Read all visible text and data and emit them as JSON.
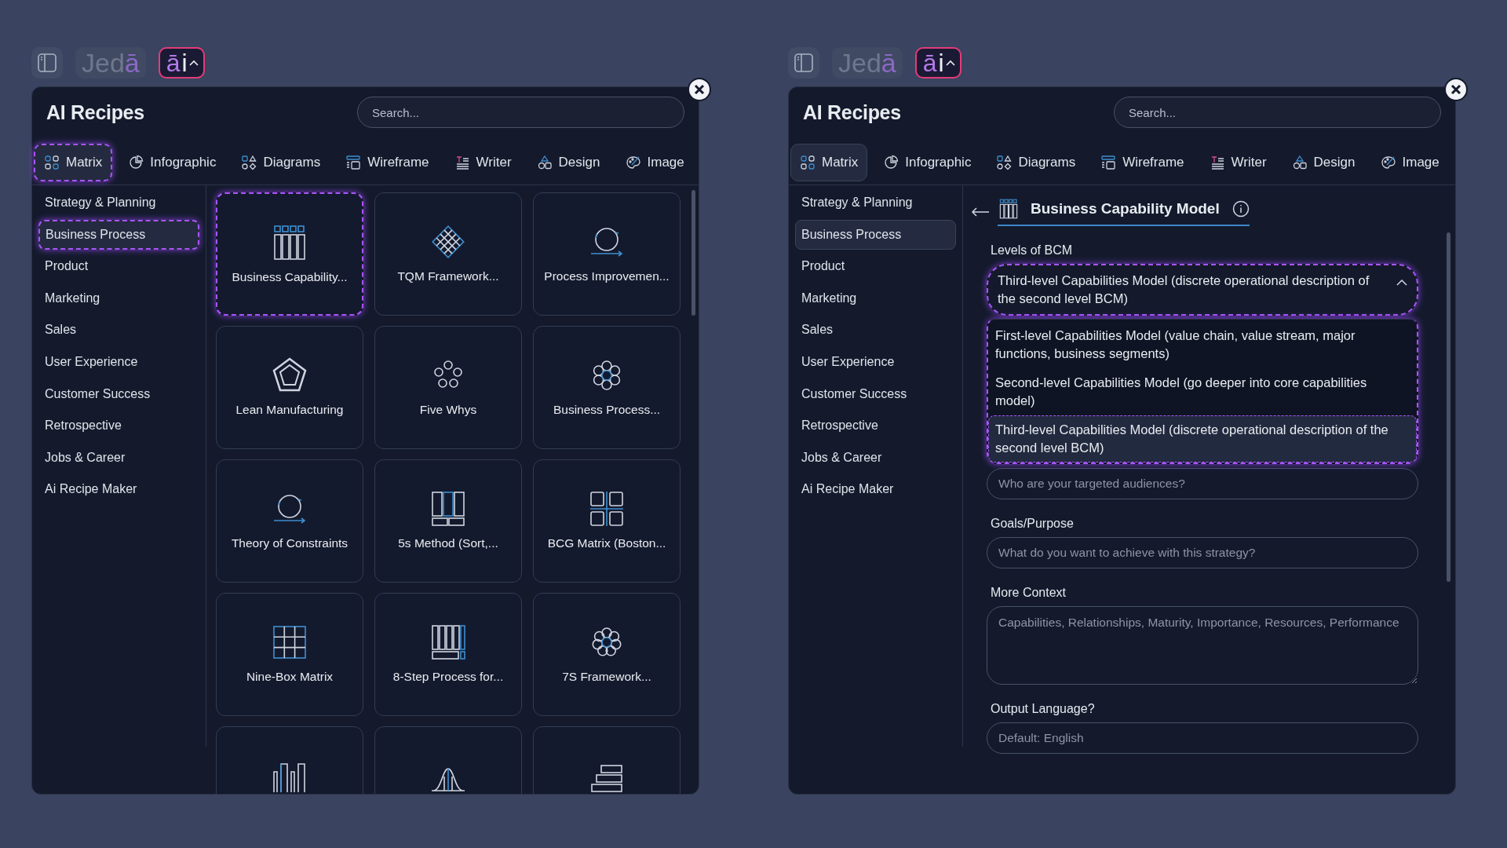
{
  "panels": [
    {
      "toolbar": {
        "logo": {
          "main": "Jed",
          "accent": "ā"
        },
        "ai_button": {
          "accent": "ā",
          "main": "i"
        }
      },
      "title": "AI Recipes",
      "search": {
        "placeholder": "Search..."
      },
      "tabs": [
        {
          "label": "Matrix",
          "selected": true,
          "focused": true
        },
        {
          "label": "Infographic",
          "selected": false,
          "focused": false
        },
        {
          "label": "Diagrams",
          "selected": false,
          "focused": false
        },
        {
          "label": "Wireframe",
          "selected": false,
          "focused": false
        },
        {
          "label": "Writer",
          "selected": false,
          "focused": false
        },
        {
          "label": "Design",
          "selected": false,
          "focused": false
        },
        {
          "label": "Image",
          "selected": false,
          "focused": false
        }
      ],
      "categories": [
        {
          "label": "Strategy & Planning",
          "selected": false,
          "focused": false
        },
        {
          "label": "Business Process",
          "selected": true,
          "focused": true
        },
        {
          "label": "Product",
          "selected": false,
          "focused": false
        },
        {
          "label": "Marketing",
          "selected": false,
          "focused": false
        },
        {
          "label": "Sales",
          "selected": false,
          "focused": false
        },
        {
          "label": "User Experience",
          "selected": false,
          "focused": false
        },
        {
          "label": "Customer Success",
          "selected": false,
          "focused": false
        },
        {
          "label": "Retrospective",
          "selected": false,
          "focused": false
        },
        {
          "label": "Jobs & Career",
          "selected": false,
          "focused": false
        },
        {
          "label": "Ai Recipe Maker",
          "selected": false,
          "focused": false
        }
      ],
      "view": {
        "kind": "grid",
        "cards": [
          {
            "label": "Business Capability...",
            "selected": true
          },
          {
            "label": "TQM Framework...",
            "selected": false
          },
          {
            "label": "Process Improvemen...",
            "selected": false
          },
          {
            "label": "Lean Manufacturing",
            "selected": false
          },
          {
            "label": "Five Whys",
            "selected": false
          },
          {
            "label": "Business Process...",
            "selected": false
          },
          {
            "label": "Theory of Constraints",
            "selected": false
          },
          {
            "label": "5s Method (Sort,...",
            "selected": false
          },
          {
            "label": "BCG Matrix (Boston...",
            "selected": false
          },
          {
            "label": "Nine-Box Matrix",
            "selected": false
          },
          {
            "label": "8-Step Process for...",
            "selected": false
          },
          {
            "label": "7S Framework...",
            "selected": false
          },
          {
            "selected": false
          },
          {
            "selected": false
          },
          {
            "selected": false
          }
        ]
      }
    },
    {
      "toolbar": {
        "logo": {
          "main": "Jed",
          "accent": "ā"
        },
        "ai_button": {
          "accent": "ā",
          "main": "i"
        }
      },
      "title": "AI Recipes",
      "search": {
        "placeholder": "Search..."
      },
      "tabs": [
        {
          "label": "Matrix",
          "selected": true,
          "focused": false
        },
        {
          "label": "Infographic",
          "selected": false,
          "focused": false
        },
        {
          "label": "Diagrams",
          "selected": false,
          "focused": false
        },
        {
          "label": "Wireframe",
          "selected": false,
          "focused": false
        },
        {
          "label": "Writer",
          "selected": false,
          "focused": false
        },
        {
          "label": "Design",
          "selected": false,
          "focused": false
        },
        {
          "label": "Image",
          "selected": false,
          "focused": false
        }
      ],
      "categories": [
        {
          "label": "Strategy & Planning",
          "selected": false,
          "focused": false
        },
        {
          "label": "Business Process",
          "selected": true,
          "focused": false
        },
        {
          "label": "Product",
          "selected": false,
          "focused": false
        },
        {
          "label": "Marketing",
          "selected": false,
          "focused": false
        },
        {
          "label": "Sales",
          "selected": false,
          "focused": false
        },
        {
          "label": "User Experience",
          "selected": false,
          "focused": false
        },
        {
          "label": "Customer Success",
          "selected": false,
          "focused": false
        },
        {
          "label": "Retrospective",
          "selected": false,
          "focused": false
        },
        {
          "label": "Jobs & Career",
          "selected": false,
          "focused": false
        },
        {
          "label": "Ai Recipe Maker",
          "selected": false,
          "focused": false
        }
      ],
      "view": {
        "kind": "form",
        "title": "Business Capability Model",
        "fields": [
          {
            "kind": "select",
            "label": "Levels of BCM",
            "value": "Third-level Capabilities Model (discrete operational description of the second level BCM)",
            "expanded": true,
            "options": [
              {
                "label": "First-level Capabilities Model (value chain, value stream, major functions, business segments)",
                "selected": false
              },
              {
                "label": "Second-level Capabilities Model (go deeper into core capabilities model)",
                "selected": false
              },
              {
                "label": "Third-level Capabilities Model (discrete operational description of the second level BCM)",
                "selected": true
              }
            ]
          },
          {
            "kind": "input",
            "placeholder": "Who are your targeted audiences?"
          },
          {
            "kind": "input",
            "label": "Goals/Purpose",
            "placeholder": "What do you want to achieve with this strategy?"
          },
          {
            "kind": "textarea",
            "label": "More Context",
            "placeholder": "Capabilities, Relationships, Maturity, Importance, Resources, Performance"
          },
          {
            "kind": "input",
            "label": "Output Language?",
            "placeholder": "Default: English"
          }
        ]
      }
    }
  ]
}
